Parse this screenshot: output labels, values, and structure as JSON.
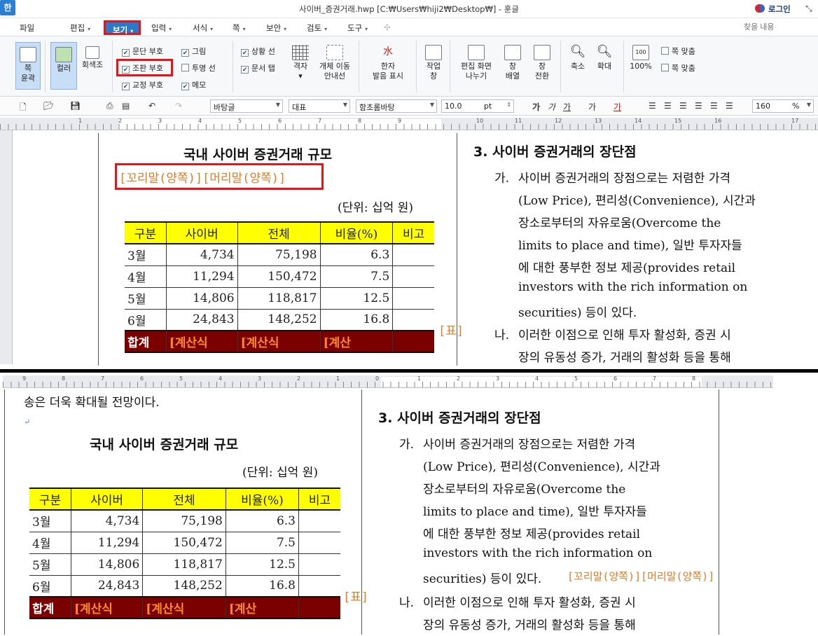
{
  "window": {
    "logo": "한",
    "title": "사이버_증권거래.hwp [C:₩Users₩hiji2₩Desktop₩] - 훈글",
    "login": "로그인",
    "restore": "⤡"
  },
  "menu": {
    "file": "파일",
    "edit": "편집",
    "view": "보기",
    "input": "입력",
    "format": "서식",
    "page": "쪽",
    "security": "보안",
    "review": "검토",
    "tools": "도구",
    "search_placeholder": "찾을 내용"
  },
  "ribbon": {
    "page_outline_1": "쪽",
    "page_outline_2": "윤곽",
    "color": "컬러",
    "grayscale": "회색조",
    "chk_para": "문단 부호",
    "chk_image": "그림",
    "chk_format": "조판 부호",
    "chk_transparent": "투명 선",
    "chk_proof": "교정 부호",
    "chk_memo": "메모",
    "chk_status": "상황 선",
    "chk_doctab": "문서 탭",
    "grid": "격자",
    "obj_move_1": "개체 이동",
    "obj_move_2": "안내선",
    "hanja_1": "한자",
    "hanja_2": "발음 표시",
    "taskpane_1": "작업",
    "taskpane_2": "창",
    "split_1": "편집 화면",
    "split_2": "나누기",
    "arrange_1": "창",
    "arrange_2": "배열",
    "switch_1": "창",
    "switch_2": "전환",
    "zoom_out": "축소",
    "zoom_in": "확대",
    "zoom_100": "100%",
    "fit_page": "쪽 맞춤",
    "fit_width": "쪽 맞춤"
  },
  "toolbar": {
    "style": "바탕글",
    "shape": "대표",
    "font": "함초롬바탕",
    "size": "10.0",
    "size_unit": "pt",
    "zoom": "160",
    "zoom_unit": "%"
  },
  "ruler_top": {
    "nums": [
      "1",
      "2",
      "3",
      "4",
      "5",
      "6",
      "7",
      "8",
      "9",
      "10",
      "11",
      "12",
      "13",
      "14",
      "15",
      "16",
      "17"
    ]
  },
  "ruler_bottom": {
    "nums": [
      "9",
      "8",
      "7",
      "6",
      "5",
      "4",
      "3",
      "2",
      "1",
      "0",
      "1",
      "2",
      "3",
      "4",
      "5",
      "6",
      "7",
      "8"
    ]
  },
  "doc_top": {
    "table_title": "국내 사이버 증권거래 규모",
    "notes": "[꼬리말(양쪽)][머리말(양쪽)]",
    "unit": "(단위: 십억 원)",
    "table_marker": "[표]",
    "section_heading": "3. 사이버 증권거래의 장단점",
    "item_ga_label": "가.",
    "item_ga_lines": [
      "사이버 증권거래의 장점으로는 저렴한 가격",
      "(Low Price), 편리성(Convenience), 시간과",
      "장소로부터의     자유로움(Overcome     the",
      "limits to place and time), 일반 투자자들",
      "에 대한 풍부한 정보 제공(provides retail",
      "investors with the rich information on",
      "securities) 등이 있다."
    ],
    "item_na_label": "나.",
    "item_na_lines": [
      "이러한 이점으로 인해 투자 활성화, 증권 시",
      "장의 유동성 증가, 거래의 활성화 등을 통해"
    ]
  },
  "doc_bottom": {
    "prev_line": "송은 더욱 확대될 전망이다.",
    "table_title": "국내 사이버 증권거래 규모",
    "unit": "(단위: 십억 원)",
    "table_marker": "[표]",
    "section_heading": "3. 사이버 증권거래의 장단점",
    "item_ga_label": "가.",
    "item_ga_lines": [
      "사이버 증권거래의 장점으로는 저렴한 가격",
      "(Low Price), 편리성(Convenience), 시간과",
      "장소로부터의     자유로움(Overcome     the",
      "limits to place and time), 일반 투자자들",
      "에 대한 풍부한 정보 제공(provides retail",
      "investors with the rich information on"
    ],
    "item_ga_last": "securities) 등이 있다.",
    "notes": "[꼬리말(양쪽)][머리말(양쪽)]",
    "item_na_label": "나.",
    "item_na_lines": [
      "이러한 이점으로 인해 투자 활성화, 증권 시",
      "장의 유동성 증가, 거래의 활성화 등을 통해"
    ]
  },
  "table": {
    "headers": [
      "구분",
      "사이버",
      "전체",
      "비율(%)",
      "비고"
    ],
    "rows": [
      [
        "3월",
        "4,734",
        "75,198",
        "6.3",
        ""
      ],
      [
        "4월",
        "11,294",
        "150,472",
        "7.5",
        ""
      ],
      [
        "5월",
        "14,806",
        "118,817",
        "12.5",
        ""
      ],
      [
        "6월",
        "24,843",
        "148,252",
        "16.8",
        ""
      ]
    ],
    "total": [
      "합계",
      "[계산식",
      "[계산식",
      "[계산",
      ""
    ]
  },
  "colors": {
    "header_bg": "#ffff00",
    "total_bg": "#7b0000",
    "marker_orange": "#e07a23",
    "highlight_red": "#e5141b",
    "menu_blue": "#2b79c8"
  }
}
